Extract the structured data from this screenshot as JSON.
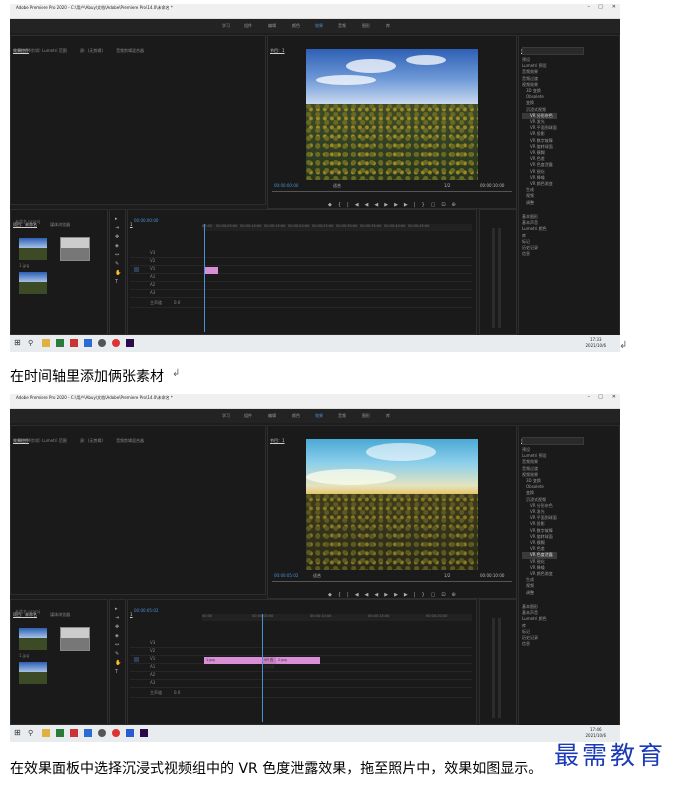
{
  "window": {
    "title": "Adobe Premiere Pro 2020 - C:\\用户\\Abuy\\文档\\Adobe\\Premiere Pro\\14.0\\未命名 *",
    "menu": [
      "文件(F)",
      "编辑(E)",
      "剪辑(C)",
      "序列(S)",
      "标记(M)",
      "图形(G)",
      "视图(V)",
      "窗口(W)",
      "帮助(H)"
    ],
    "workspaces": [
      "学习",
      "组件",
      "编辑",
      "颜色",
      "效果",
      "音频",
      "图形",
      "库"
    ],
    "active_workspace": "效果"
  },
  "project_panel": {
    "tabs": [
      "效果控件",
      "Lumetri 范围",
      "源：(无剪辑)",
      "音频剪辑混合器"
    ],
    "empty_note": "（未选择剪辑）"
  },
  "program_panel": {
    "title": "节目：1",
    "fit_label": "适合",
    "ratio": "1/2",
    "end_time": "00:00:10:00"
  },
  "effects_panel": {
    "title": "效果",
    "tree": [
      "预设",
      "Lumetri 预设",
      "音频效果",
      "音频过渡",
      "视频效果",
      "3D 变换",
      "Obsolete",
      "变换",
      "图像控制",
      "实用程序",
      "扭曲",
      "时间",
      "杂色与颗粒",
      "模糊与锐化",
      "沉浸式视频",
      "VR 分形杂色",
      "VR 发光",
      "VR 平面到球面",
      "VR 投影",
      "VR 数字故障",
      "VR 旋转球面",
      "VR 模糊",
      "VR 色差",
      "VR 色度泄露",
      "VR 锐化",
      "VR 降噪",
      "VR 颜色渐变",
      "生成",
      "视频",
      "调整",
      "过时",
      "过渡",
      "透视",
      "通道",
      "键控",
      "颜色校正",
      "风格化",
      "视频过渡"
    ],
    "lower_items": [
      "基本图形",
      "基本声音",
      "Lumetri 颜色",
      "库",
      "标记",
      "历史记录",
      "信息"
    ]
  },
  "media_panel": {
    "tabs": [
      "项目：未命名",
      "媒体浏览器"
    ],
    "project_file": "未命名.prproj",
    "clip_name": "1.jpg"
  },
  "timeline": {
    "title": "1",
    "ruler": [
      "00:00",
      "00:00:05:00",
      "00:00:10:00",
      "00:00:15:00",
      "00:00:20:00",
      "00:00:25:00",
      "00:00:30:00",
      "00:00:35:00",
      "00:00:40:00",
      "00:00:45:00"
    ],
    "tracks": [
      "V3",
      "V2",
      "V1",
      "A1",
      "A2",
      "A3",
      "主声道"
    ],
    "master_value": "0.0"
  },
  "screenshots": [
    {
      "timecode": "00:00:00:00",
      "timeline_tc": "00:00:00:00",
      "clips": [
        "1.jpg"
      ],
      "clock_time": "17:33",
      "clock_date": "2021/10/6"
    },
    {
      "timecode": "00:00:05:02",
      "timeline_tc": "00:00:05:02",
      "clips": [
        "1.jpg",
        "VR 色度泄露",
        "2.jpg"
      ],
      "clock_time": "17:46",
      "clock_date": "2021/10/6"
    }
  ],
  "captions": {
    "caption1": "在时间轴里添加俩张素材",
    "caption2": "在效果面板中选择沉浸式视频组中的 VR 色度泄露效果，拖至照片中，效果如图显示。"
  },
  "watermark": "最需教育",
  "colors": {
    "accent": "#4a8fd8",
    "clip": "#d98fd6",
    "brand": "#1a3ab8"
  }
}
